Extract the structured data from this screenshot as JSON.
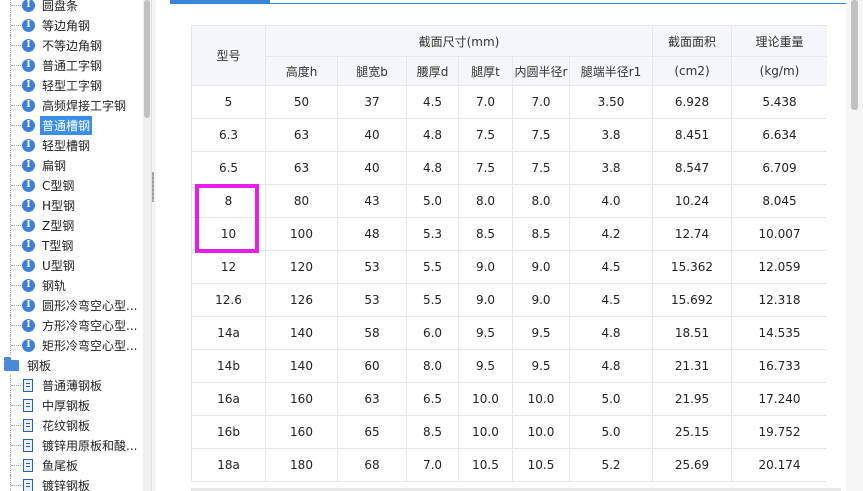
{
  "tree": {
    "items": [
      {
        "label": "圆盘条",
        "icon": "info-icon",
        "selected": false
      },
      {
        "label": "等边角钢",
        "icon": "info-icon",
        "selected": false
      },
      {
        "label": "不等边角钢",
        "icon": "info-icon",
        "selected": false
      },
      {
        "label": "普通工字钢",
        "icon": "info-icon",
        "selected": false
      },
      {
        "label": "轻型工字钢",
        "icon": "info-icon",
        "selected": false
      },
      {
        "label": "高频焊接工字钢",
        "icon": "info-icon",
        "selected": false
      },
      {
        "label": "普通槽钢",
        "icon": "info-icon",
        "selected": true
      },
      {
        "label": "轻型槽钢",
        "icon": "info-icon",
        "selected": false
      },
      {
        "label": "扁钢",
        "icon": "info-icon",
        "selected": false
      },
      {
        "label": "C型钢",
        "icon": "info-icon",
        "selected": false
      },
      {
        "label": "H型钢",
        "icon": "info-icon",
        "selected": false
      },
      {
        "label": "Z型钢",
        "icon": "info-icon",
        "selected": false
      },
      {
        "label": "T型钢",
        "icon": "info-icon",
        "selected": false
      },
      {
        "label": "U型钢",
        "icon": "info-icon",
        "selected": false
      },
      {
        "label": "钢轨",
        "icon": "info-icon",
        "selected": false
      },
      {
        "label": "圆形冷弯空心型...",
        "icon": "info-icon",
        "selected": false
      },
      {
        "label": "方形冷弯空心型...",
        "icon": "info-icon",
        "selected": false
      },
      {
        "label": "矩形冷弯空心型...",
        "icon": "info-icon",
        "selected": false
      }
    ],
    "folder": {
      "label": "钢板",
      "icon": "folder-icon"
    },
    "sub_items": [
      {
        "label": "普通薄钢板",
        "icon": "document-icon"
      },
      {
        "label": "中厚钢板",
        "icon": "document-icon"
      },
      {
        "label": "花纹钢板",
        "icon": "document-icon"
      },
      {
        "label": "镀锌用原板和酸...",
        "icon": "document-icon"
      },
      {
        "label": "鱼尾板",
        "icon": "document-icon"
      },
      {
        "label": "镀锌钢板",
        "icon": "document-icon"
      }
    ]
  },
  "table": {
    "header": {
      "model": "型号",
      "section_group": "截面尺寸(mm)",
      "section_cols": [
        "高度h",
        "腿宽b",
        "腰厚d",
        "腿厚t",
        "内圆半径r",
        "腿端半径r1"
      ],
      "area": "截面面积",
      "area_unit": "(cm2)",
      "weight": "理论重量",
      "weight_unit": "(kg/m)"
    },
    "rows": [
      [
        "5",
        "50",
        "37",
        "4.5",
        "7.0",
        "7.0",
        "3.50",
        "6.928",
        "5.438"
      ],
      [
        "6.3",
        "63",
        "40",
        "4.8",
        "7.5",
        "7.5",
        "3.8",
        "8.451",
        "6.634"
      ],
      [
        "6.5",
        "63",
        "40",
        "4.8",
        "7.5",
        "7.5",
        "3.8",
        "8.547",
        "6.709"
      ],
      [
        "8",
        "80",
        "43",
        "5.0",
        "8.0",
        "8.0",
        "4.0",
        "10.24",
        "8.045"
      ],
      [
        "10",
        "100",
        "48",
        "5.3",
        "8.5",
        "8.5",
        "4.2",
        "12.74",
        "10.007"
      ],
      [
        "12",
        "120",
        "53",
        "5.5",
        "9.0",
        "9.0",
        "4.5",
        "15.362",
        "12.059"
      ],
      [
        "12.6",
        "126",
        "53",
        "5.5",
        "9.0",
        "9.0",
        "4.5",
        "15.692",
        "12.318"
      ],
      [
        "14a",
        "140",
        "58",
        "6.0",
        "9.5",
        "9.5",
        "4.8",
        "18.51",
        "14.535"
      ],
      [
        "14b",
        "140",
        "60",
        "8.0",
        "9.5",
        "9.5",
        "4.8",
        "21.31",
        "16.733"
      ],
      [
        "16a",
        "160",
        "63",
        "6.5",
        "10.0",
        "10.0",
        "5.0",
        "21.95",
        "17.240"
      ],
      [
        "16b",
        "160",
        "65",
        "8.5",
        "10.0",
        "10.0",
        "5.0",
        "25.15",
        "19.752"
      ],
      [
        "18a",
        "180",
        "68",
        "7.0",
        "10.5",
        "10.5",
        "5.2",
        "25.69",
        "20.174"
      ]
    ]
  },
  "colors": {
    "accent": "#3a86d4",
    "selected": "#3a8ee6",
    "highlight": "#e81ee8"
  }
}
